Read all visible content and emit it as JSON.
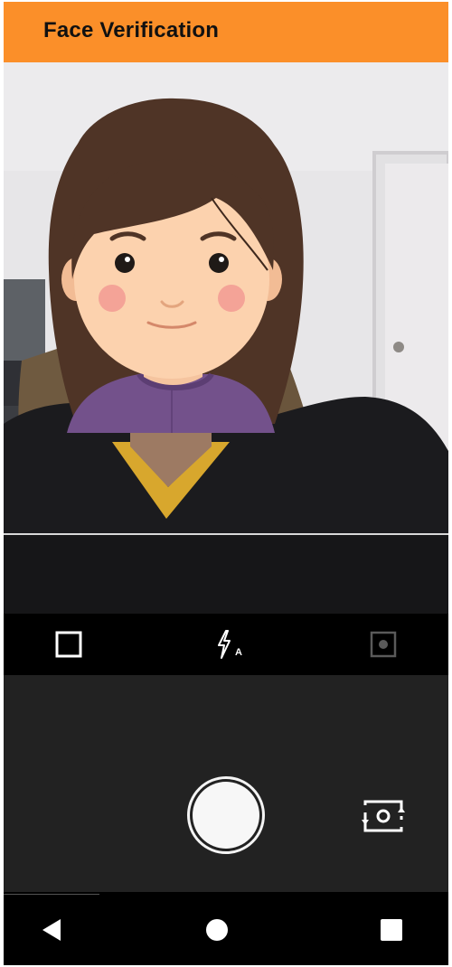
{
  "app": {
    "title": "Face Verification",
    "accent_color": "#fb8f29"
  },
  "camera": {
    "controls": [
      {
        "name": "aspect-ratio-icon"
      },
      {
        "name": "flash-auto-icon",
        "label": "A"
      },
      {
        "name": "camera-mode-icon"
      }
    ],
    "shutter": {
      "name": "shutter-button"
    },
    "switch": {
      "name": "switch-camera-icon"
    }
  },
  "system_nav": {
    "buttons": [
      {
        "name": "back-icon"
      },
      {
        "name": "home-icon"
      },
      {
        "name": "recents-icon"
      }
    ]
  }
}
